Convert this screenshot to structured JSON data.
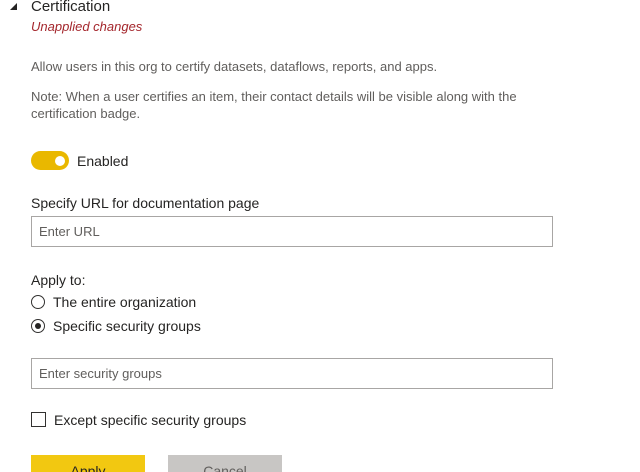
{
  "section": {
    "title": "Certification",
    "status": "Unapplied changes",
    "collapse_icon": "triangle-down-icon"
  },
  "description": "Allow users in this org to certify datasets, dataflows, reports, and apps.",
  "note": "Note: When a user certifies an item, their contact details will be visible along with the certification badge.",
  "toggle": {
    "label": "Enabled",
    "state": "on",
    "color": "#f2c811"
  },
  "documentation_url": {
    "label": "Specify URL for documentation page",
    "placeholder": "Enter URL",
    "value": ""
  },
  "apply_to": {
    "label": "Apply to:",
    "options": [
      {
        "label": "The entire organization",
        "selected": false
      },
      {
        "label": "Specific security groups",
        "selected": true
      }
    ]
  },
  "security_groups": {
    "placeholder": "Enter security groups",
    "value": ""
  },
  "except_groups": {
    "label": "Except specific security groups",
    "checked": false
  },
  "buttons": {
    "apply": "Apply",
    "cancel": "Cancel"
  },
  "colors": {
    "accent": "#f2c811",
    "warning_text": "#a4262c"
  }
}
